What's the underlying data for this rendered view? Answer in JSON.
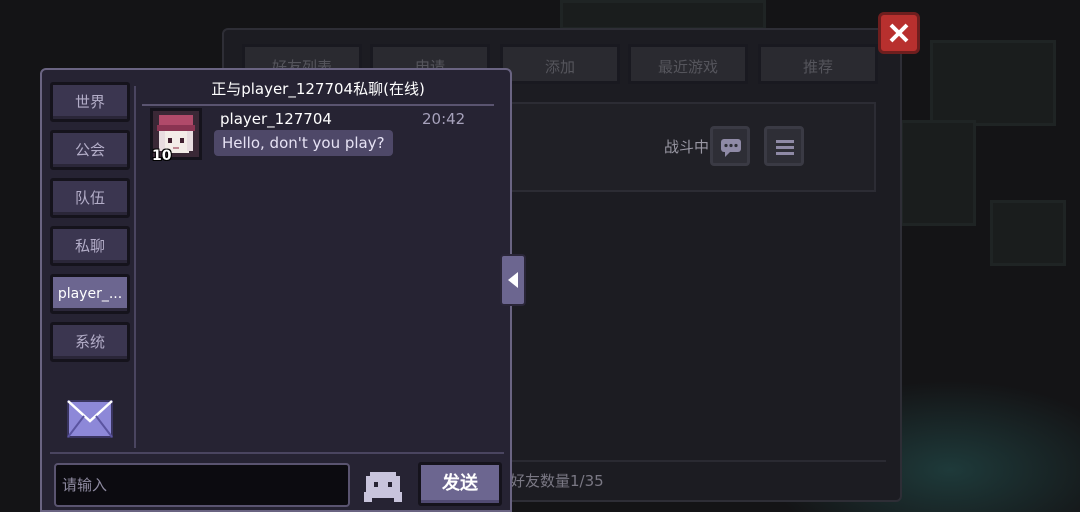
{
  "friends": {
    "tabs": [
      "好友列表",
      "申请",
      "添加",
      "最近游戏",
      "推荐"
    ],
    "row": {
      "status": "战斗中"
    },
    "count_text": "好友数量1/35"
  },
  "chat": {
    "channels": [
      "世界",
      "公会",
      "队伍",
      "私聊",
      "player_...",
      "系统"
    ],
    "active_channel_index": 4,
    "title": "正与player_127704私聊(在线)",
    "messages": [
      {
        "sender": "player_127704",
        "time": "20:42",
        "text": "Hello, don't you play?",
        "level": "10"
      }
    ],
    "input_placeholder": "请输入",
    "send_label": "发送"
  },
  "colors": {
    "panel_bg": "#262333",
    "button_bg": "#3b3650",
    "active_button_bg": "#6c6690",
    "close_red": "#b8302e"
  },
  "icons": {
    "mail": "mail-icon",
    "emoji": "emoji-icon",
    "collapse": "chevron-left-icon",
    "close": "close-icon",
    "chat": "chat-bubble-icon",
    "menu": "menu-icon"
  }
}
